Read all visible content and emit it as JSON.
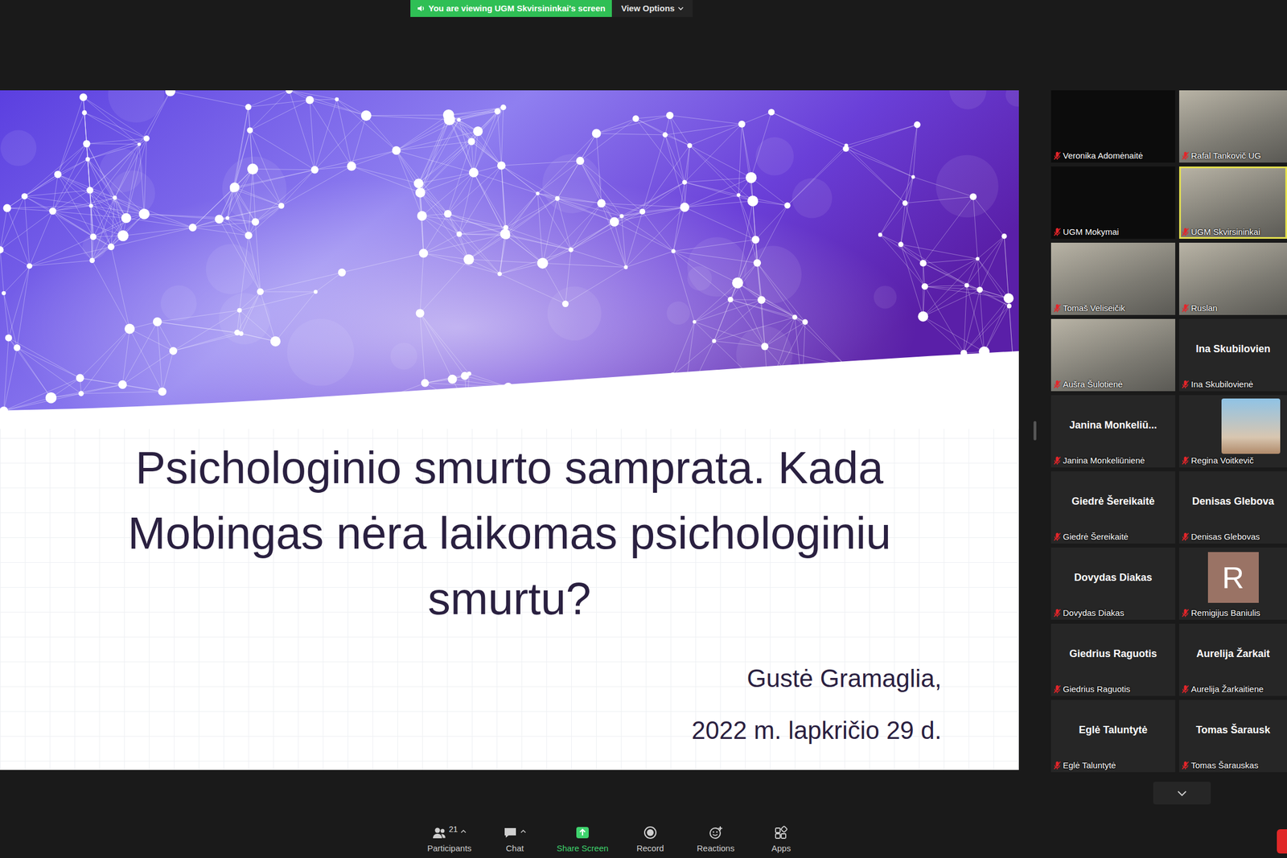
{
  "banner": {
    "text": "You are viewing UGM Skvirsininkai's screen"
  },
  "view_options": {
    "label": "View Options"
  },
  "slide": {
    "title_lines": [
      "Psichologinio smurto samprata. Kada",
      "Mobingas nėra laikomas psichologiniu",
      "smurtu?"
    ],
    "author": "Gustė Gramaglia,",
    "date": "2022 m. lapkričio 29 d."
  },
  "gallery": {
    "tiles": [
      {
        "kind": "blank",
        "label": "Veronika Adomėnaitė",
        "muted": true,
        "speaking": false
      },
      {
        "kind": "video",
        "label": "Rafal Tankovič  UG",
        "muted": true,
        "speaking": false
      },
      {
        "kind": "blank",
        "label": "UGM Mokymai",
        "muted": true,
        "speaking": false
      },
      {
        "kind": "video",
        "label": "UGM Skvirsininkai",
        "muted": true,
        "speaking": true
      },
      {
        "kind": "video",
        "label": "Tomaš Veliseičik",
        "muted": true,
        "speaking": false
      },
      {
        "kind": "video",
        "label": "Ruslan",
        "muted": true,
        "speaking": false
      },
      {
        "kind": "video",
        "label": "Aušra Šulotienė",
        "muted": true,
        "speaking": false
      },
      {
        "kind": "name",
        "display_name": "Ina Skubilovien",
        "label": "Ina Skubilovienė",
        "muted": true,
        "speaking": false
      },
      {
        "kind": "name",
        "display_name": "Janina  Monkeliū...",
        "label": "Janina Monkeliūnienė",
        "muted": true,
        "speaking": false
      },
      {
        "kind": "photo",
        "label": "Regina Voitkevič",
        "muted": true,
        "speaking": false
      },
      {
        "kind": "name",
        "display_name": "Giedrė Šereikaitė",
        "label": "Giedrė Šereikaitė",
        "muted": true,
        "speaking": false
      },
      {
        "kind": "name",
        "display_name": "Denisas Glebova",
        "label": "Denisas Glebovas",
        "muted": true,
        "speaking": false
      },
      {
        "kind": "name",
        "display_name": "Dovydas Diakas",
        "label": "Dovydas Diakas",
        "muted": true,
        "speaking": false
      },
      {
        "kind": "avatar",
        "initial": "R",
        "label": "Remigijus Baniulis",
        "muted": true,
        "speaking": false
      },
      {
        "kind": "name",
        "display_name": "Giedrius Raguotis",
        "label": "Giedrius Raguotis",
        "muted": true,
        "speaking": false
      },
      {
        "kind": "name",
        "display_name": "Aurelija  Žarkait",
        "label": "Aurelija Žarkaitiene",
        "muted": true,
        "speaking": false
      },
      {
        "kind": "name",
        "display_name": "Eglė Taluntytė",
        "label": "Eglė Taluntytė",
        "muted": true,
        "speaking": false
      },
      {
        "kind": "name",
        "display_name": "Tomas Šarausk",
        "label": "Tomas Šarauskas",
        "muted": true,
        "speaking": false
      }
    ]
  },
  "toolbar": {
    "items": [
      {
        "label": "Participants",
        "count": "21",
        "caret": true,
        "active": false
      },
      {
        "label": "Chat",
        "caret": true,
        "active": false
      },
      {
        "label": "Share Screen",
        "caret": false,
        "active": true
      },
      {
        "label": "Record",
        "caret": false,
        "active": false
      },
      {
        "label": "Reactions",
        "caret": false,
        "active": false
      },
      {
        "label": "Apps",
        "caret": false,
        "active": false
      }
    ]
  }
}
